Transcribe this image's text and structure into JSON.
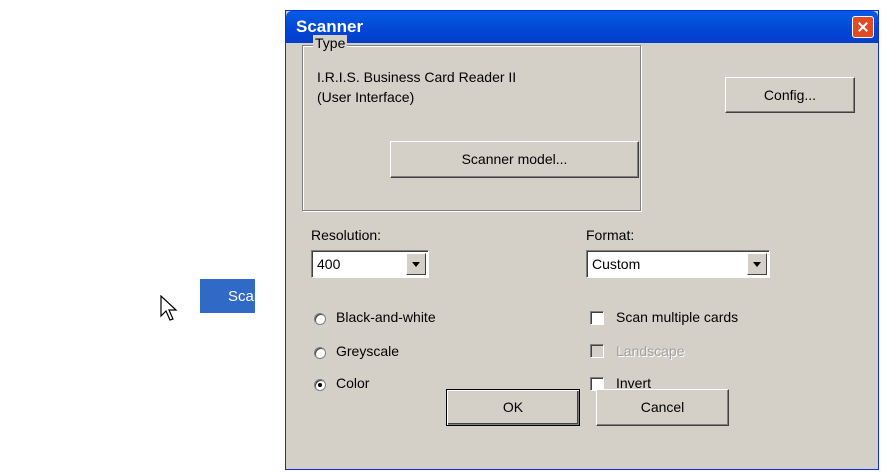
{
  "menu": {
    "item_label": "Scanner..."
  },
  "dialog": {
    "title": "Scanner",
    "type_group": {
      "legend": "Type",
      "line1": "I.R.I.S. Business Card Reader II",
      "line2": "(User Interface)",
      "scanner_model_button": "Scanner model..."
    },
    "config_button": "Config...",
    "resolution": {
      "label": "Resolution:",
      "value": "400"
    },
    "format": {
      "label": "Format:",
      "value": "Custom"
    },
    "color_mode": {
      "options": [
        "Black-and-white",
        "Greyscale",
        "Color"
      ],
      "selected": "Color"
    },
    "options": {
      "scan_multiple": "Scan multiple cards",
      "landscape": "Landscape",
      "invert": "Invert"
    },
    "ok_button": "OK",
    "cancel_button": "Cancel"
  },
  "colors": {
    "title_bar": "#0345d6",
    "dialog_bg": "#d4d0c8",
    "menu_highlight": "#3169c6",
    "close_button": "#e04a24"
  }
}
